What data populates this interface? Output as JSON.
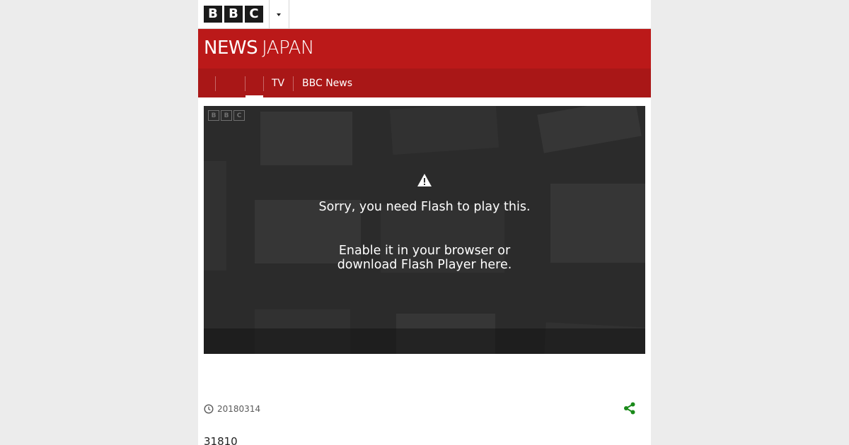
{
  "bbc_logo": [
    "B",
    "B",
    "C"
  ],
  "brand": {
    "news": "NEWS",
    "region": "JAPAN",
    "color": "#bb1919"
  },
  "nav": {
    "items": [
      "",
      "",
      "TV",
      "BBC News"
    ],
    "active_index": 1
  },
  "player": {
    "message_line1": "Sorry, you need Flash to play this.",
    "message_line2": "Enable it in your browser or download Flash Player here.",
    "mini_logo": [
      "B",
      "B",
      "C"
    ]
  },
  "meta": {
    "date": "20180314",
    "share_color": "#1a8a1a"
  },
  "counter": "31810"
}
